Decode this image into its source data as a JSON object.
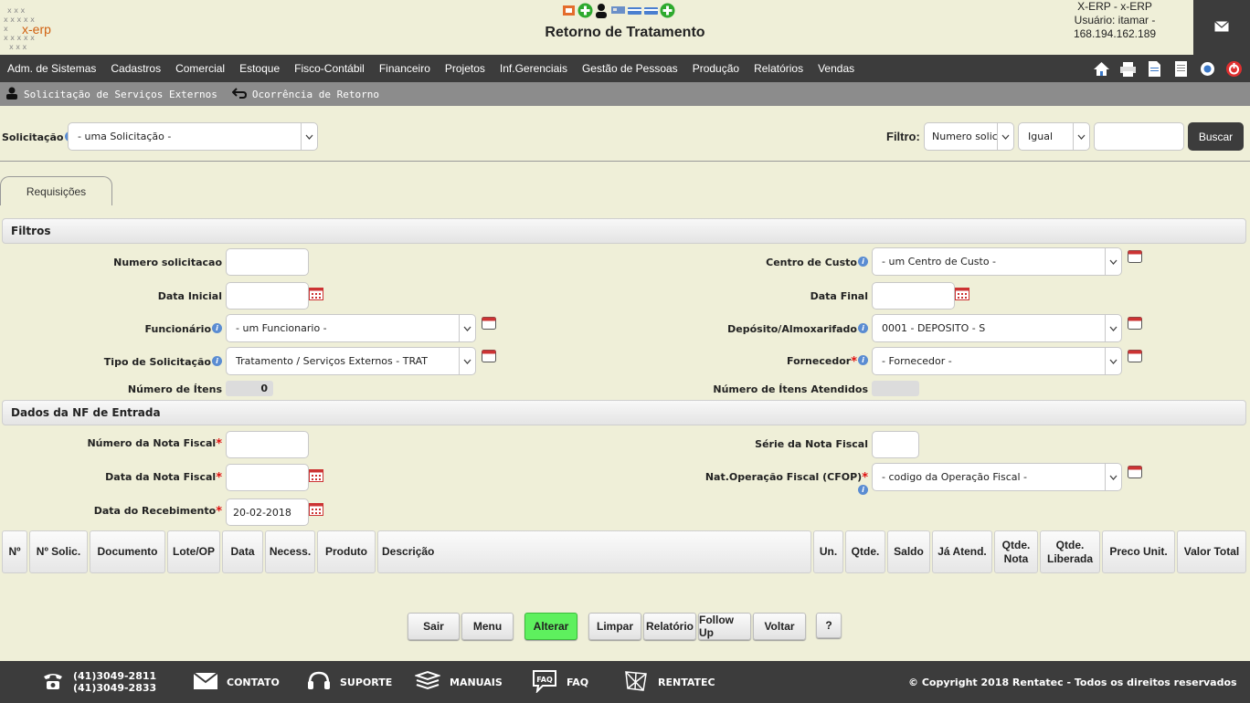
{
  "header": {
    "logo_text": "x-erp",
    "title": "Retorno de Tratamento",
    "user_line1": "X-ERP - x-ERP",
    "user_line2": "Usuário: itamar -",
    "user_line3": "168.194.162.189"
  },
  "menu": [
    "Adm. de Sistemas",
    "Cadastros",
    "Comercial",
    "Estoque",
    "Fisco-Contábil",
    "Financeiro",
    "Projetos",
    "Inf.Gerenciais",
    "Gestão de Pessoas",
    "Produção",
    "Relatórios",
    "Vendas"
  ],
  "subnav": {
    "item1": "Solicitação de Serviços Externos",
    "item2": "Ocorrência de Retorno"
  },
  "top": {
    "solicitacao_label": "Solicitação",
    "solicitacao_value": "- uma Solicitação -",
    "filtro_label": "Filtro:",
    "filtro_field": "Numero solic",
    "filtro_op": "Igual",
    "filtro_value": "",
    "buscar": "Buscar"
  },
  "tab": "Requisições",
  "filtros": {
    "title": "Filtros",
    "numero_solicitacao": "Numero solicitacao",
    "data_inicial": "Data Inicial",
    "funcionario": "Funcionário",
    "funcionario_value": "- um Funcionario -",
    "tipo_solicitacao": "Tipo de Solicitação",
    "tipo_value": "Tratamento / Serviços Externos - TRAT",
    "numero_itens": "Número de Ítens",
    "numero_itens_value": "0",
    "centro_custo": "Centro de Custo",
    "centro_custo_value": "- um Centro de Custo -",
    "data_final": "Data Final",
    "deposito": "Depósito/Almoxarifado",
    "deposito_value": "0001 - DEPOSITO - S",
    "fornecedor": "Fornecedor",
    "fornecedor_value": "- Fornecedor -",
    "itens_atendidos": "Número de Ítens Atendidos"
  },
  "nf": {
    "title": "Dados da NF de Entrada",
    "numero_nf": "Número da Nota Fiscal",
    "data_nf": "Data da Nota Fiscal",
    "data_recebimento": "Data do Recebimento",
    "data_recebimento_value": "20-02-2018",
    "serie_nf": "Série da Nota Fiscal",
    "cfop": "Nat.Operação Fiscal (CFOP)",
    "cfop_value": "- codigo da Operação Fiscal -"
  },
  "table_headers": {
    "n": "Nº",
    "nsolic": "Nº Solic.",
    "documento": "Documento",
    "lote": "Lote/OP",
    "data": "Data",
    "necess": "Necess.",
    "produto": "Produto",
    "descricao": "Descrição",
    "un": "Un.",
    "qtde": "Qtde.",
    "saldo": "Saldo",
    "ja_atend": "Já Atend.",
    "qtde_nota_1": "Qtde.",
    "qtde_nota_2": "Nota",
    "qtde_lib_1": "Qtde.",
    "qtde_lib_2": "Liberada",
    "preco": "Preco Unit.",
    "valor": "Valor Total"
  },
  "buttons": {
    "sair": "Sair",
    "menu": "Menu",
    "alterar": "Alterar",
    "limpar": "Limpar",
    "relatorio": "Relatório",
    "followup": "Follow Up",
    "voltar": "Voltar",
    "help": "?"
  },
  "footer": {
    "phone1": "(41)3049-2811",
    "phone2": "(41)3049-2833",
    "contato": "CONTATO",
    "suporte": "SUPORTE",
    "manuais": "MANUAIS",
    "faq": "FAQ",
    "faq_icon_text": "FAQ",
    "rentatec": "RENTATEC",
    "copyright": "© Copyright 2018 Rentatec - Todos os direitos reservados"
  },
  "colors": {
    "background": "#efefd8",
    "bar": "#3c3c3c",
    "subbar": "#8c8c8c",
    "accent_green": "#5ef05e",
    "required": "#e01010"
  }
}
